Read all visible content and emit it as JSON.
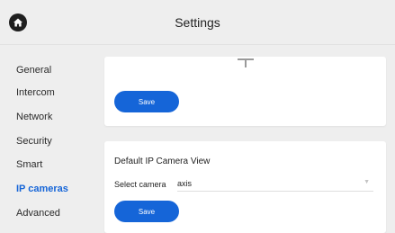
{
  "header": {
    "title": "Settings",
    "home_icon": "home-icon"
  },
  "sidebar": {
    "items": [
      {
        "label": "General",
        "active": false
      },
      {
        "label": "Intercom",
        "active": false
      },
      {
        "label": "Network",
        "active": false
      },
      {
        "label": "Security",
        "active": false
      },
      {
        "label": "Smart",
        "active": false
      },
      {
        "label": "IP cameras",
        "active": true
      },
      {
        "label": "Advanced",
        "active": false
      }
    ]
  },
  "top_card": {
    "save_label": "Save"
  },
  "camera_card": {
    "title": "Default IP Camera View",
    "select_label": "Select camera",
    "select_value": "axis",
    "save_label": "Save"
  },
  "colors": {
    "accent": "#1565d8",
    "background": "#eeeeee",
    "card": "#ffffff"
  }
}
